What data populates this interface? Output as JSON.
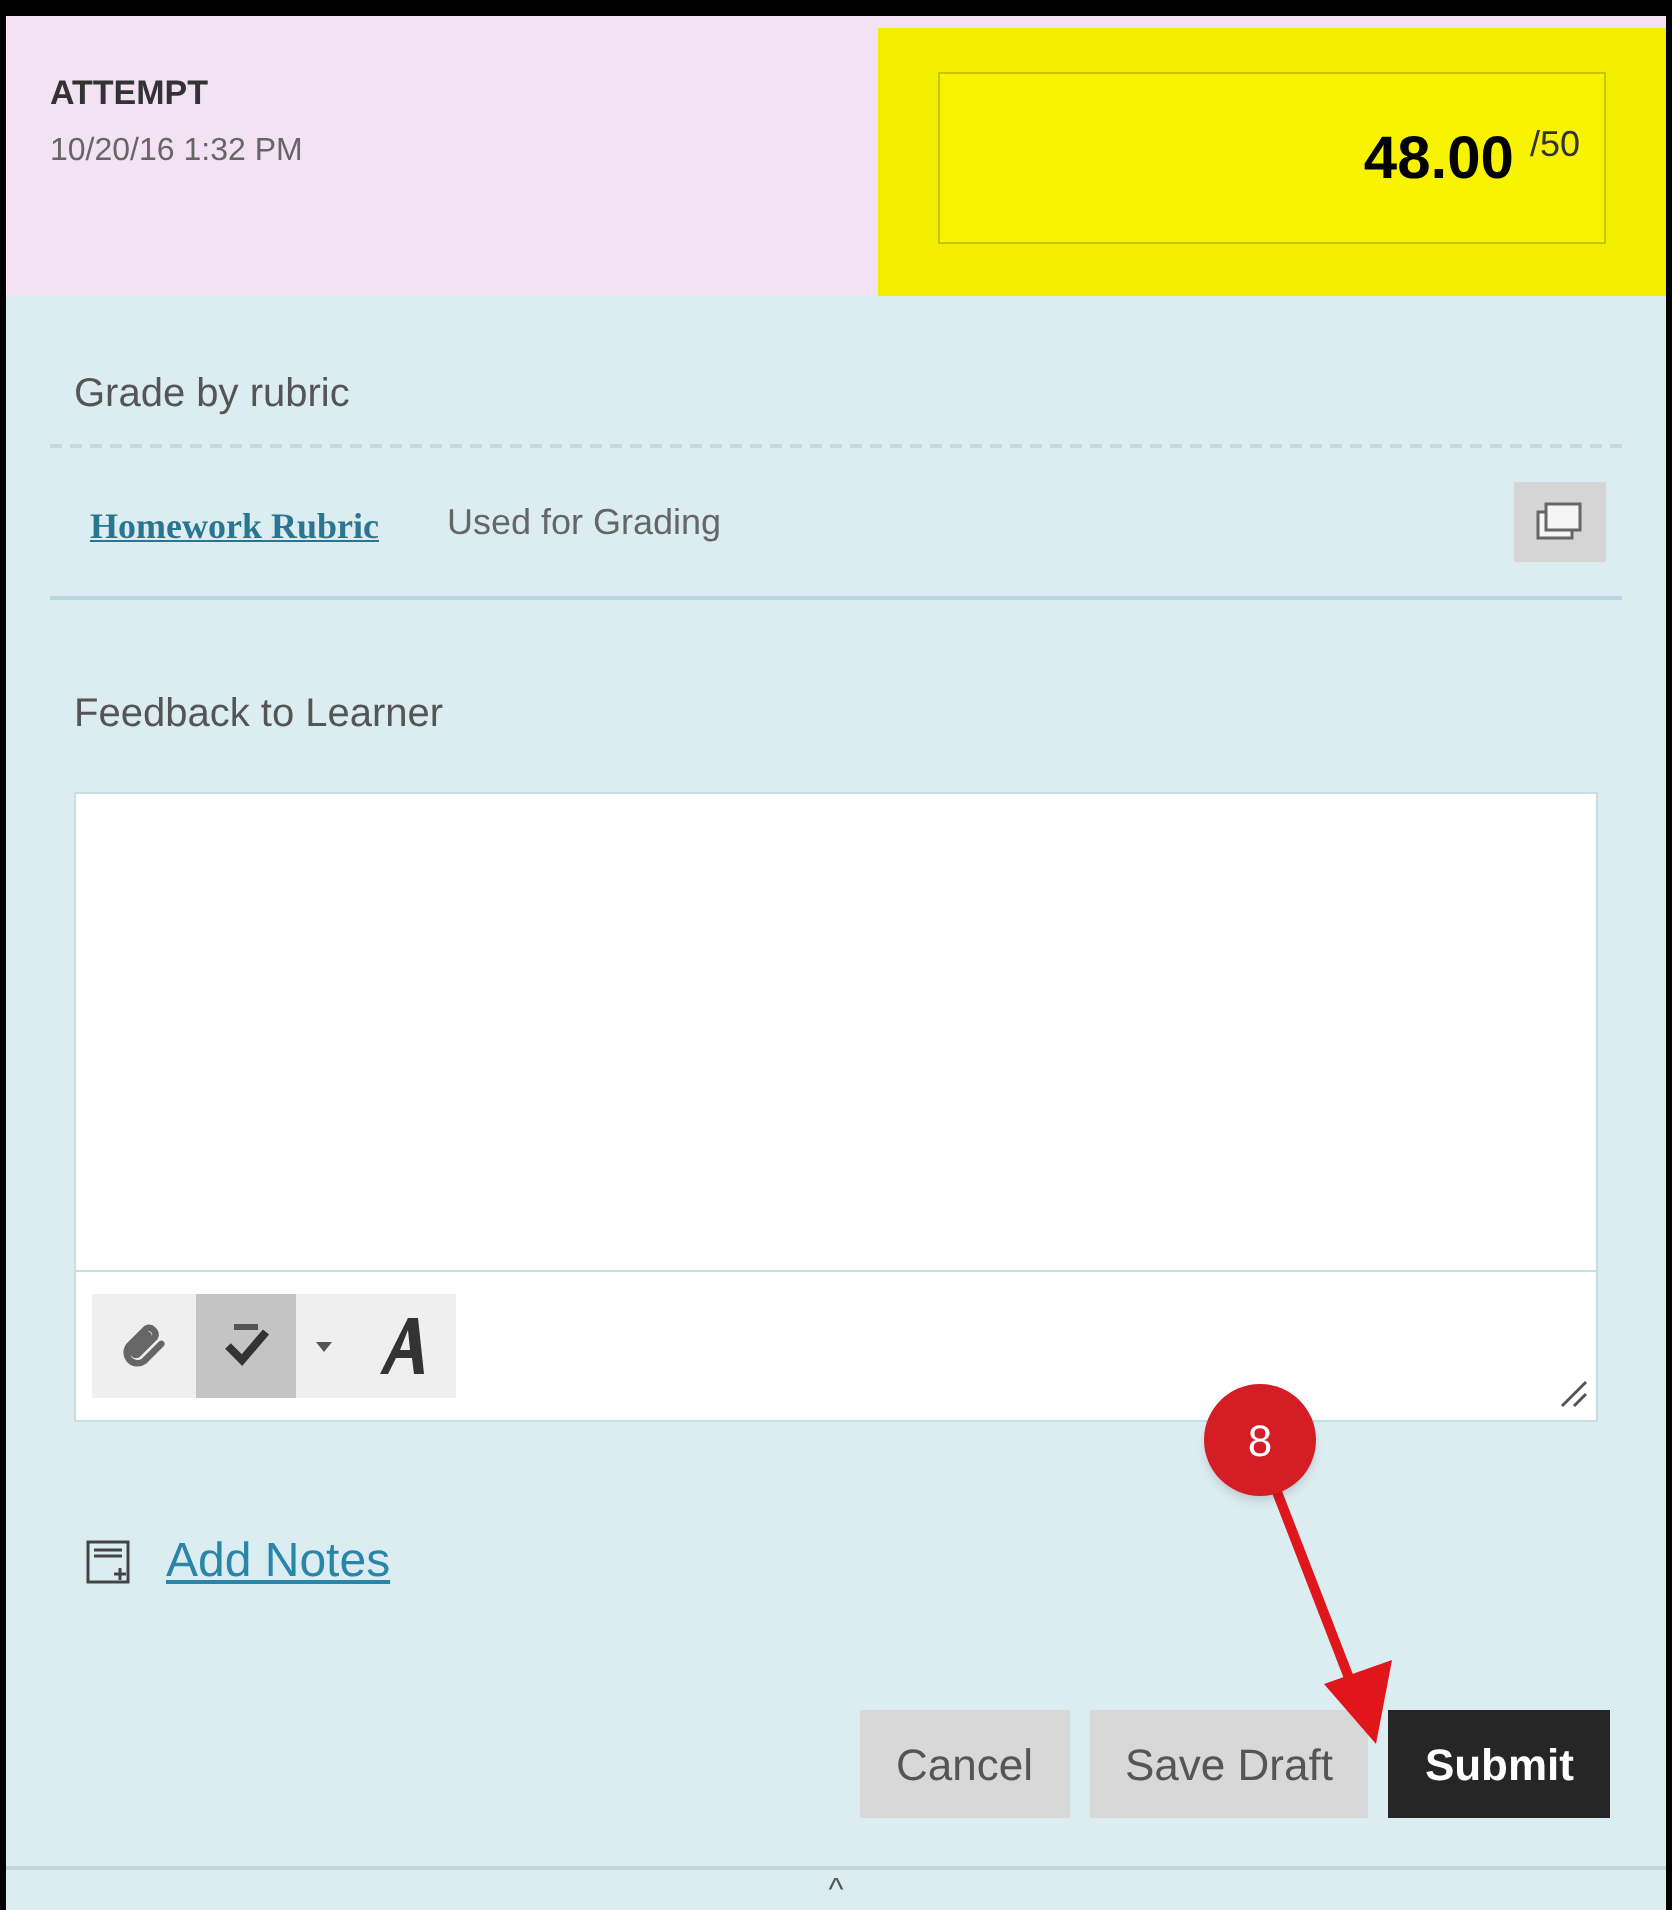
{
  "header": {
    "title": "ATTEMPT",
    "date": "10/20/16 1:32 PM",
    "score": "48.00",
    "max": "/50",
    "highlighted": true
  },
  "rubric": {
    "heading": "Grade by rubric",
    "link": "Homework Rubric",
    "status": "Used for Grading"
  },
  "feedback": {
    "label": "Feedback to Learner",
    "toolbar": [
      {
        "kind": "attach",
        "pressed": false
      },
      {
        "kind": "spellcheck",
        "pressed": true
      },
      {
        "kind": "dropdown",
        "pressed": false
      },
      {
        "kind": "font",
        "pressed": false
      }
    ]
  },
  "add_notes": "Add Notes",
  "buttons": [
    {
      "label": "Cancel",
      "kind": "secondary"
    },
    {
      "label": "Save Draft",
      "kind": "secondary"
    },
    {
      "label": "Submit",
      "kind": "primary"
    }
  ],
  "callout": {
    "number": "8"
  },
  "collapse": "^"
}
